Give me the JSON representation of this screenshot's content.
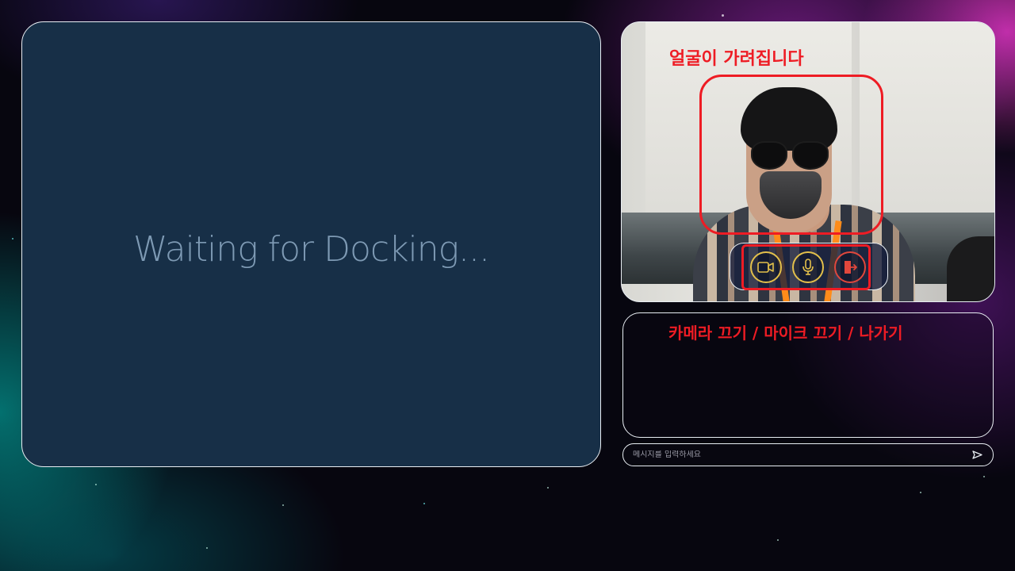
{
  "main": {
    "waiting_text": "Waiting for Docking..."
  },
  "video": {
    "face_annotation": "얼굴이 가려집니다"
  },
  "controls": {
    "annotation": "카메라 끄기 / 마이크 끄기 / 나가기",
    "camera_icon": "video-camera-icon",
    "mic_icon": "microphone-icon",
    "exit_icon": "exit-door-icon"
  },
  "chat": {
    "placeholder": "메시지를 입력하세요",
    "send_icon": "send-icon"
  },
  "colors": {
    "panel_bg": "#172f47",
    "panel_border": "#e9eef3",
    "waiting_text": "#7e9ab4",
    "annotation_red": "#ee1c24",
    "control_gold": "#e3c04b",
    "exit_red": "#e0473c"
  }
}
